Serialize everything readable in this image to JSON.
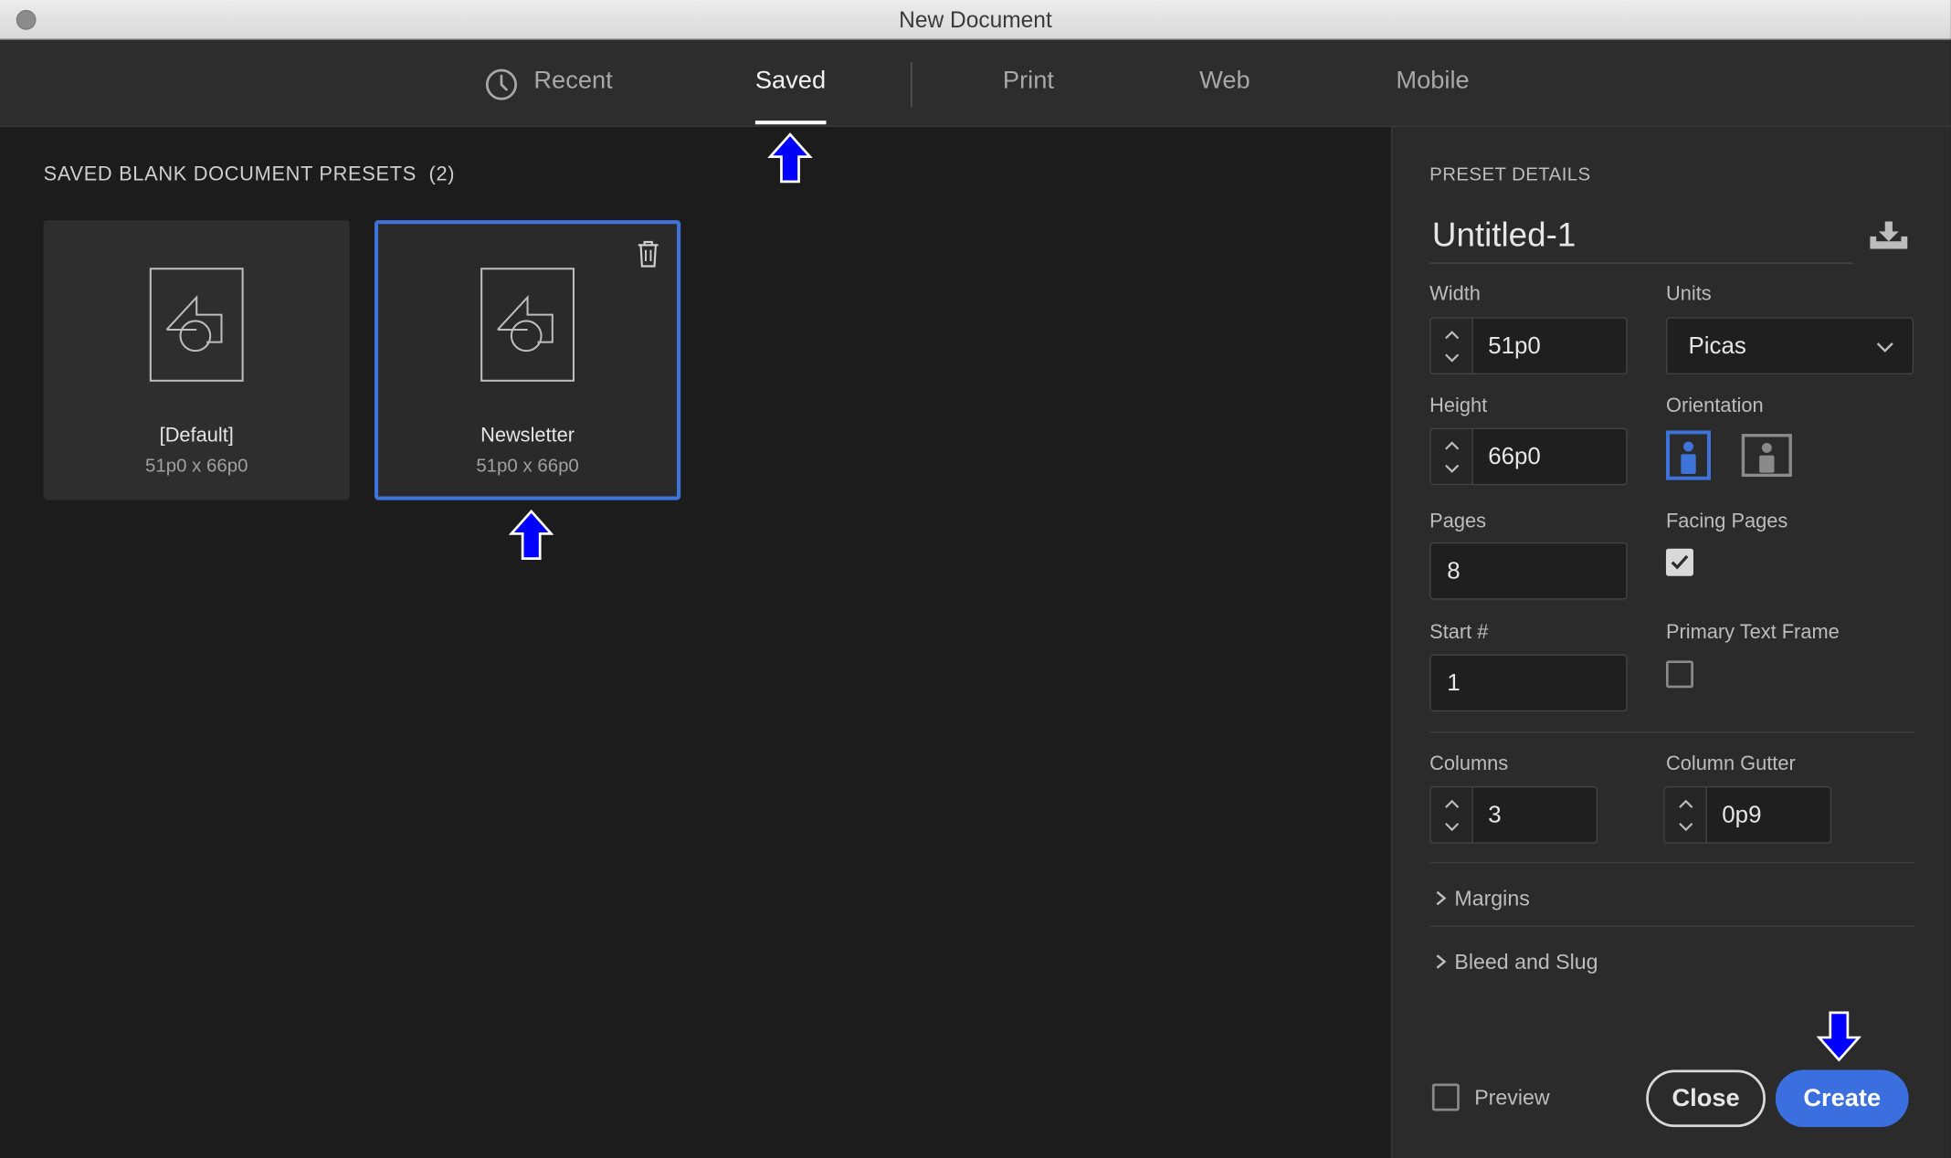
{
  "window": {
    "title": "New Document"
  },
  "tabs": [
    {
      "label": "Recent",
      "icon": "clock-icon"
    },
    {
      "label": "Saved"
    },
    {
      "label": "Print"
    },
    {
      "label": "Web"
    },
    {
      "label": "Mobile"
    }
  ],
  "active_tab": "Saved",
  "presets_section": {
    "title": "SAVED BLANK DOCUMENT PRESETS",
    "count": "(2)",
    "items": [
      {
        "name": "[Default]",
        "size": "51p0 x 66p0"
      },
      {
        "name": "Newsletter",
        "size": "51p0 x 66p0",
        "selected": true
      }
    ]
  },
  "preset_details": {
    "title": "PRESET DETAILS",
    "name": "Untitled-1",
    "width_label": "Width",
    "width": "51p0",
    "units_label": "Units",
    "units": "Picas",
    "height_label": "Height",
    "height": "66p0",
    "orientation_label": "Orientation",
    "orientation": "portrait",
    "pages_label": "Pages",
    "pages": "8",
    "facing_pages_label": "Facing Pages",
    "facing_pages": true,
    "start_label": "Start #",
    "start": "1",
    "primary_text_frame_label": "Primary Text Frame",
    "primary_text_frame": false,
    "columns_label": "Columns",
    "columns": "3",
    "column_gutter_label": "Column Gutter",
    "column_gutter": "0p9",
    "margins_label": "Margins",
    "bleed_label": "Bleed and Slug"
  },
  "footer": {
    "preview_label": "Preview",
    "preview": false,
    "close_label": "Close",
    "create_label": "Create"
  },
  "colors": {
    "accent": "#3b6fe0",
    "selection_border": "#3e73d9",
    "annotation_arrow": "#0000ff"
  }
}
